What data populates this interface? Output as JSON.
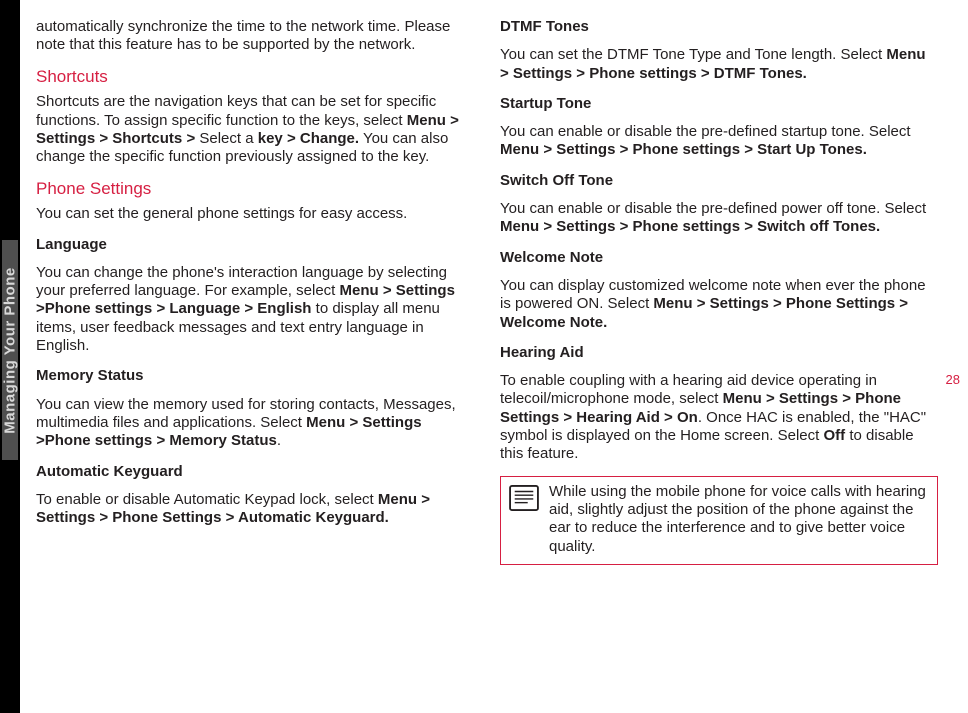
{
  "sideTab": "Managing Your Phone",
  "pageNumber": "28",
  "col1": {
    "p1a": "automatically synchronize the time to the network time. Please note that this feature has to be supported by the network.",
    "h1": "Shortcuts",
    "p2a": "Shortcuts are the navigation keys that can be set for specific functions. To assign specific function to the keys, select ",
    "p2b": "Menu > Settings > Shortcuts > ",
    "p2c": "Select a ",
    "p2d": "key > Change.",
    "p2e": " You can also change the specific function previously assigned to the key.",
    "h2": "Phone Settings",
    "p3": "You can set the general phone settings for easy access.",
    "h3": "Language",
    "p4a": "You can change the phone's interaction language by selecting your preferred language. For example, select ",
    "p4b": "Menu > Settings >Phone settings > Language > English",
    "p4c": " to display all menu items, user feedback messages and text entry language in English.",
    "h4": "Memory Status",
    "p5a": "You can view the memory used for storing contacts, Messages, multimedia files and applications. Select ",
    "p5b": "Menu > Settings >Phone settings > Memory Status",
    "p5c": ".",
    "h5": "Automatic Keyguard",
    "p6a": "To enable or disable Automatic Keypad lock, select ",
    "p6b": "Menu > Settings > Phone Settings > Automatic Keyguard."
  },
  "col2": {
    "h1": "DTMF Tones",
    "p1a": "You can set the DTMF Tone Type and Tone length. Select ",
    "p1b": "Menu > Settings > Phone settings > DTMF Tones.",
    "h2": "Startup Tone",
    "p2a": "You can enable or disable the pre-defined startup tone. Select  ",
    "p2b": "Menu > Settings > Phone settings > Start Up Tones.",
    "h3": "Switch Off Tone",
    "p3a": "You can enable or disable the pre-defined power off tone. Select  ",
    "p3b": "Menu > Settings > Phone settings > Switch off Tones.",
    "h4": "Welcome Note",
    "p4a": "You can display customized welcome note when ever the phone is powered ON. Select  ",
    "p4b": "Menu > Settings > Phone Settings > Welcome Note.",
    "h5": "Hearing Aid",
    "p5a": "To enable coupling with a hearing aid device operating in telecoil/microphone mode, select ",
    "p5b": "Menu > Settings > Phone Settings > Hearing Aid > On",
    "p5c": ". Once HAC is enabled, the \"HAC\" symbol is displayed on the Home screen. Select ",
    "p5d": "Off",
    "p5e": " to disable this feature.",
    "note": "While using the mobile phone for voice calls with hearing aid, slightly adjust the position of the phone against the ear to reduce the interference and to give better voice quality."
  }
}
